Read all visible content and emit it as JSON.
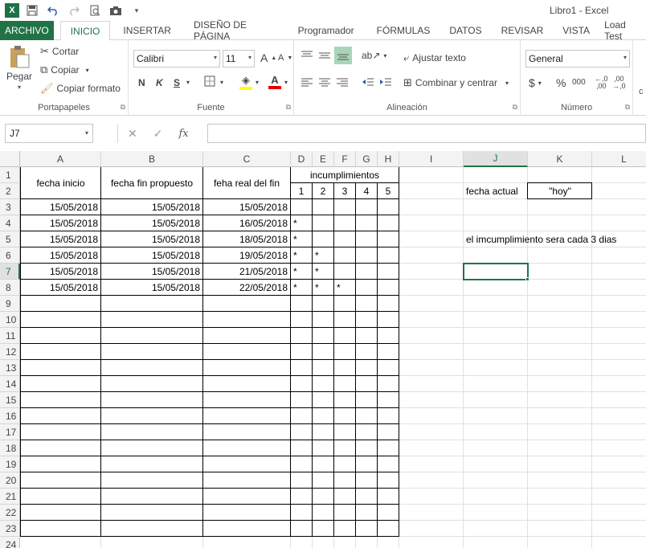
{
  "window_title": "Libro1 - Excel",
  "tabs": [
    "ARCHIVO",
    "INICIO",
    "INSERTAR",
    "DISEÑO DE PÁGINA",
    "Programador",
    "FÓRMULAS",
    "DATOS",
    "REVISAR",
    "VISTA",
    "Load Test"
  ],
  "ribbon": {
    "clipboard": {
      "paste": "Pegar",
      "cut": "Cortar",
      "copy": "Copiar",
      "format_painter": "Copiar formato",
      "label": "Portapapeles"
    },
    "font": {
      "name": "Calibri",
      "size": "11",
      "label": "Fuente",
      "bold": "N",
      "italic": "K",
      "underline": "S"
    },
    "alignment": {
      "wrap": "Ajustar texto",
      "merge": "Combinar y centrar",
      "label": "Alineación"
    },
    "number": {
      "format": "General",
      "label": "Número",
      "currency": "$",
      "percent": "%",
      "thousands": "000"
    }
  },
  "formula_bar": {
    "name_box": "J7",
    "fx": "fx",
    "content": ""
  },
  "columns": [
    "A",
    "B",
    "C",
    "D",
    "E",
    "F",
    "G",
    "H",
    "I",
    "J",
    "K",
    "L"
  ],
  "rows": [
    "1",
    "2",
    "3",
    "4",
    "5",
    "6",
    "7",
    "8",
    "9",
    "10",
    "11",
    "12",
    "13",
    "14",
    "15",
    "16",
    "17",
    "18",
    "19",
    "20",
    "21",
    "22",
    "23",
    "24"
  ],
  "selected_cell": "J7",
  "sheet": {
    "headers": {
      "fecha_inicio": "fecha inicio",
      "fecha_fin_propuesto": "fecha fin propuesto",
      "fecha_real": "feha real del fin",
      "incumplimientos": "incumplimientos",
      "inc_cols": [
        "1",
        "2",
        "3",
        "4",
        "5"
      ]
    },
    "data_rows": [
      {
        "a": "15/05/2018",
        "b": "15/05/2018",
        "c": "15/05/2018",
        "d": "",
        "e": "",
        "f": ""
      },
      {
        "a": "15/05/2018",
        "b": "15/05/2018",
        "c": "16/05/2018",
        "d": "*",
        "e": "",
        "f": ""
      },
      {
        "a": "15/05/2018",
        "b": "15/05/2018",
        "c": "18/05/2018",
        "d": "*",
        "e": "",
        "f": ""
      },
      {
        "a": "15/05/2018",
        "b": "15/05/2018",
        "c": "19/05/2018",
        "d": "*",
        "e": "*",
        "f": ""
      },
      {
        "a": "15/05/2018",
        "b": "15/05/2018",
        "c": "21/05/2018",
        "d": "*",
        "e": "*",
        "f": ""
      },
      {
        "a": "15/05/2018",
        "b": "15/05/2018",
        "c": "22/05/2018",
        "d": "*",
        "e": "*",
        "f": "*"
      }
    ],
    "fecha_actual_label": "fecha actual",
    "hoy_value": "\"hoy\"",
    "note": "el imcumplimiento sera cada 3 dias"
  },
  "colors": {
    "accent": "#217346",
    "file_tab": "#217346"
  }
}
